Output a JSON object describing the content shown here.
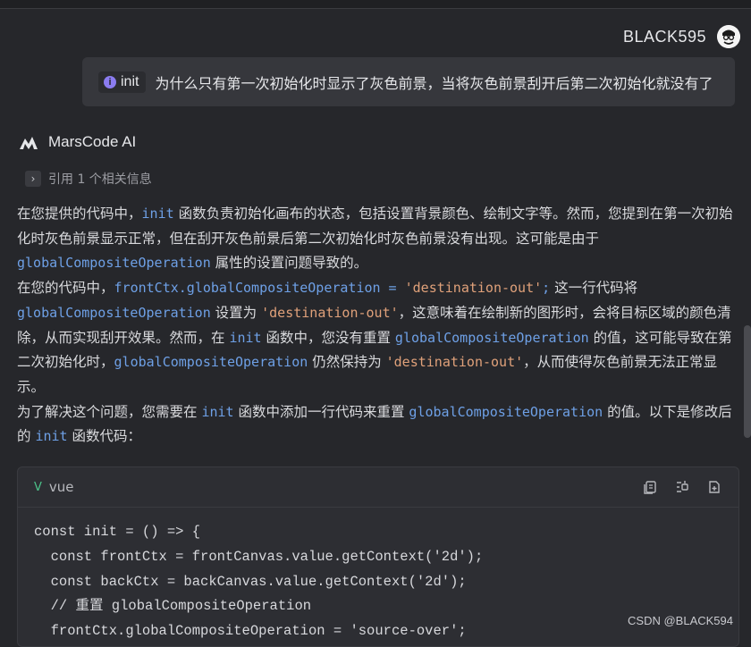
{
  "user": {
    "name": "BLACK595"
  },
  "question": {
    "tag_icon": "i",
    "tag_label": "init",
    "text": "为什么只有第一次初始化时显示了灰色前景，当将灰色前景刮开后第二次初始化就没有了"
  },
  "assistant": {
    "name": "MarsCode AI",
    "reference": "引用 1 个相关信息"
  },
  "answer": {
    "p1": {
      "t0": "在您提供的代码中，",
      "c0": "init",
      "t1": " 函数负责初始化画布的状态，包括设置背景颜色、绘制文字等。然而，您提到在第一次初始化时灰色前景显示正常，但在刮开灰色前景后第二次初始化时灰色前景没有出现。这可能是由于 ",
      "c1": "globalCompositeOperation",
      "t2": " 属性的设置问题导致的。"
    },
    "p2": {
      "t0": "在您的代码中，",
      "c0": "frontCtx.globalCompositeOperation = ",
      "s0": "'destination-out'",
      "c1": ";",
      "t1": " 这一行代码将 ",
      "c2": "globalCompositeOperation",
      "t2": " 设置为 ",
      "s1": "'destination-out'",
      "t3": "，这意味着在绘制新的图形时，会将目标区域的颜色清除，从而实现刮开效果。然而，在 ",
      "c3": "init",
      "t4": " 函数中，您没有重置 ",
      "c4": "globalCompositeOperation",
      "t5": " 的值，这可能导致在第二次初始化时，",
      "c5": "globalCompositeOperation",
      "t6": " 仍然保持为 ",
      "s2": "'destination-out'",
      "t7": "，从而使得灰色前景无法正常显示。"
    },
    "p3": {
      "t0": "为了解决这个问题，您需要在 ",
      "c0": "init",
      "t1": " 函数中添加一行代码来重置 ",
      "c1": "globalCompositeOperation",
      "t2": " 的值。以下是修改后的 ",
      "c2": "init",
      "t3": " 函数代码："
    }
  },
  "code_block": {
    "language": "vue",
    "lines": [
      "const init = () => {",
      "  const frontCtx = frontCanvas.value.getContext('2d');",
      "  const backCtx = backCanvas.value.getContext('2d');",
      "  // 重置 globalCompositeOperation",
      "  frontCtx.globalCompositeOperation = 'source-over';"
    ]
  },
  "icons": {
    "avatar": "avatar-icon",
    "logo": "marscode-logo-icon",
    "chevron": "chevron-right-icon",
    "lang": "vue-icon",
    "actions": [
      "copy-icon",
      "insert-icon",
      "new-file-icon"
    ]
  },
  "watermark": "CSDN @BLACK594"
}
